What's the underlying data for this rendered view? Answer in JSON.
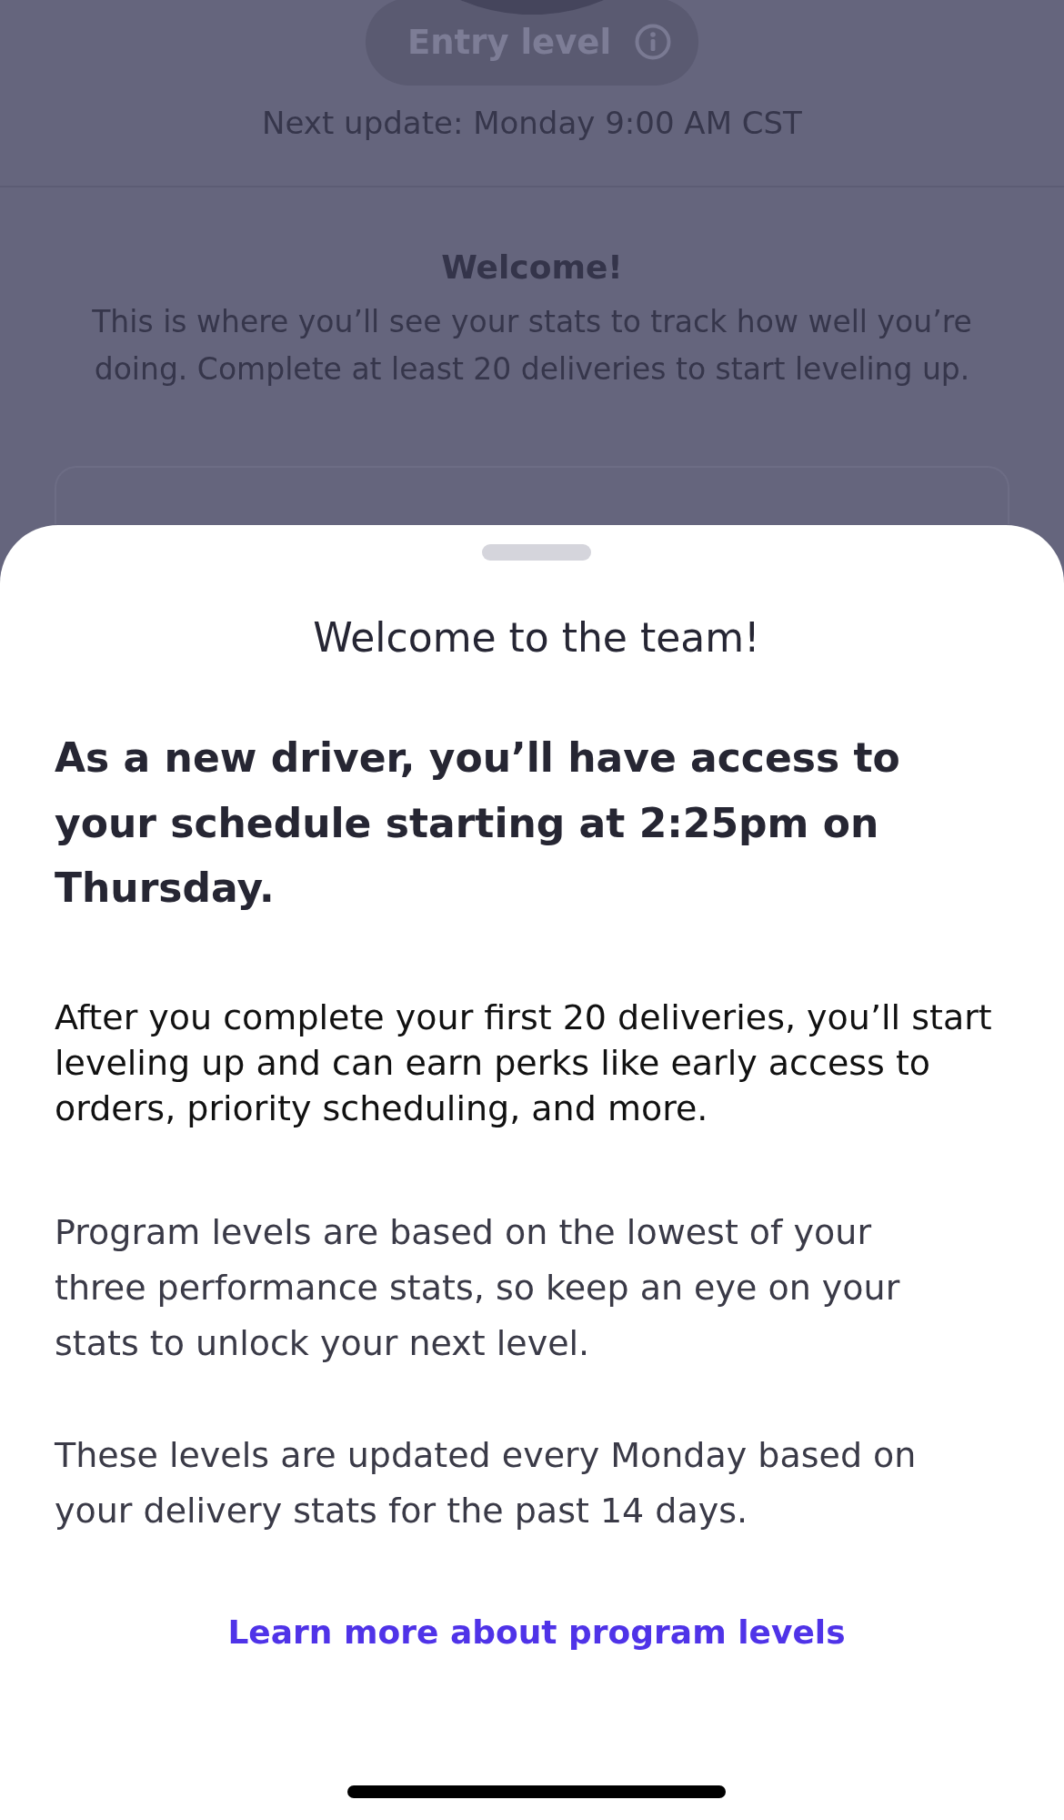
{
  "background": {
    "level_badge": {
      "label": "Entry level"
    },
    "next_update": "Next update: Monday 9:00 AM CST",
    "welcome": {
      "title": "Welcome!",
      "body": "This is where you’ll see your stats to track how well you’re doing. Complete at least 20 deliveries to start leveling up."
    }
  },
  "sheet": {
    "title": "Welcome to the team!",
    "headline": "As a new driver, you’ll have access to your schedule starting at 2:25pm on Thursday.",
    "paragraphs": [
      {
        "kind": "primary",
        "text": "After you complete your first 20 deliveries, you’ll start leveling up and can earn perks like early access to orders, priority scheduling, and more."
      },
      {
        "kind": "secondary",
        "text": "Program levels are based on the lowest of your three performance stats, so keep an eye on your stats to unlock your next level."
      },
      {
        "kind": "secondary",
        "text": "These levels are updated every Monday based on your delivery stats for the past 14 days."
      }
    ],
    "link": "Learn more about program levels"
  }
}
